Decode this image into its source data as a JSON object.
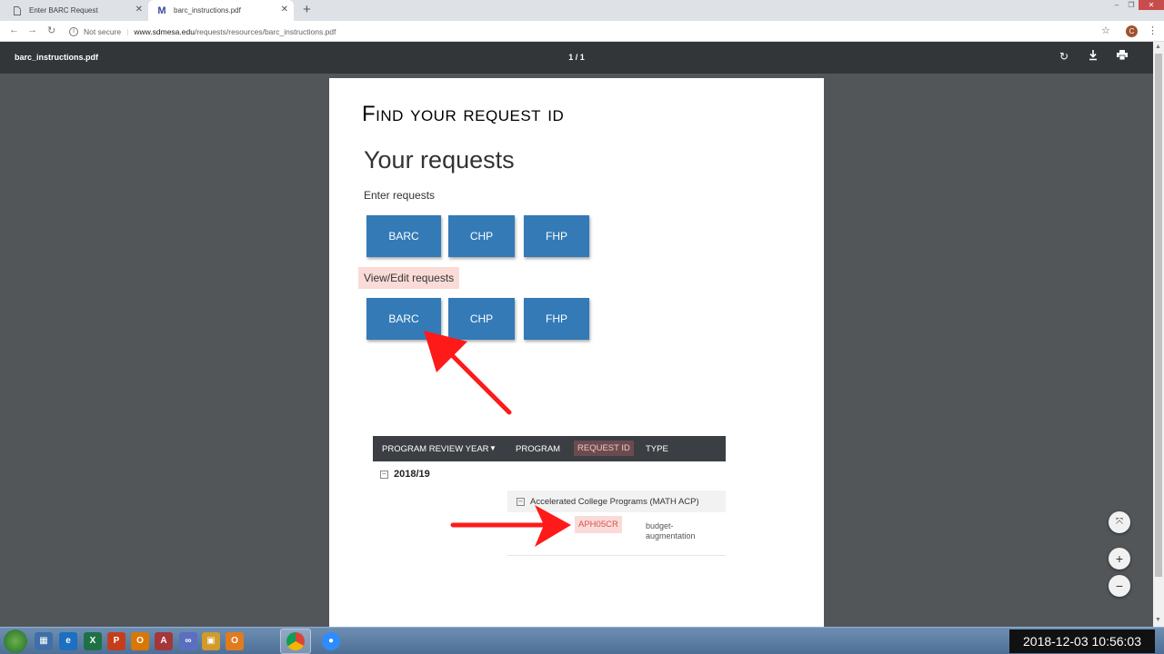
{
  "browser": {
    "tabs": [
      {
        "title": "Enter BARC Request",
        "active": false
      },
      {
        "title": "barc_instructions.pdf",
        "active": true
      }
    ],
    "new_tab_label": "+",
    "security_label": "Not secure",
    "url_host": "www.sdmesa.edu",
    "url_path": "/requests/resources/barc_instructions.pdf",
    "profile_initial": "C"
  },
  "pdf_viewer": {
    "filename": "barc_instructions.pdf",
    "page_indicator": "1 / 1"
  },
  "document": {
    "title": "Find your request id",
    "heading": "Your requests",
    "enter_label": "Enter requests",
    "enter_buttons": [
      "BARC",
      "CHP",
      "FHP"
    ],
    "view_label": "View/Edit requests",
    "view_buttons": [
      "BARC",
      "CHP",
      "FHP"
    ],
    "table": {
      "columns": [
        "PROGRAM REVIEW YEAR",
        "PROGRAM",
        "REQUEST ID",
        "TYPE"
      ],
      "year": "2018/19",
      "program": "Accelerated College Programs (MATH ACP)",
      "request_id": "APH05CR",
      "type_line1": "budget-",
      "type_line2": "augmentation"
    },
    "highlight_color": "#fadbd8",
    "button_color": "#337ab7",
    "arrow_color": "#ff1a1a"
  },
  "taskbar": {
    "clock": "2018-12-03  10:56:03"
  }
}
